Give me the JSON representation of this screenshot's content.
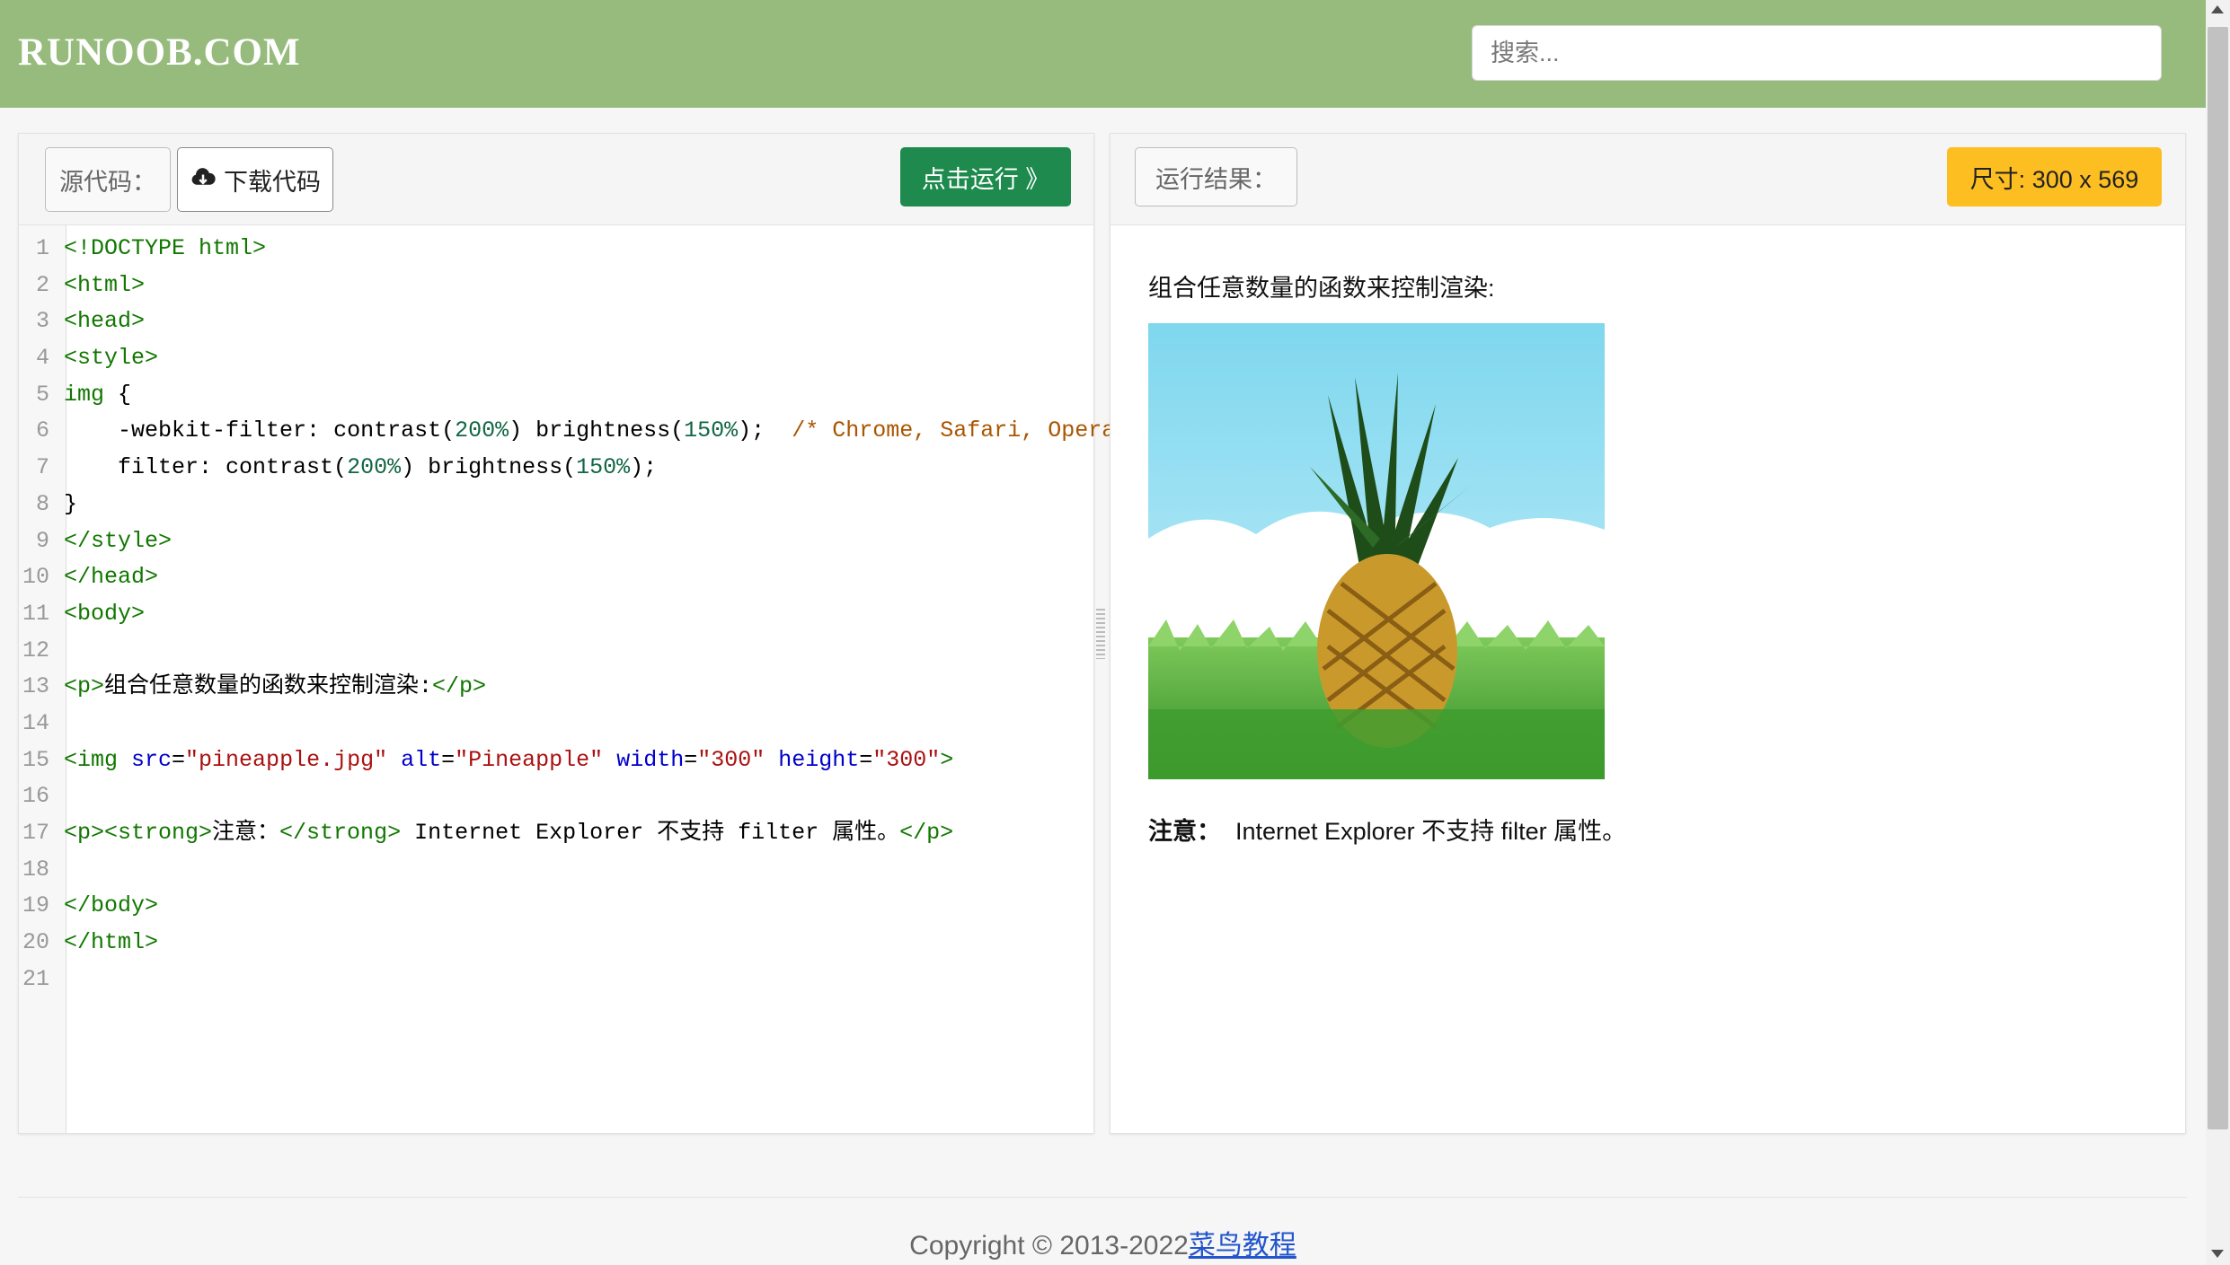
{
  "header": {
    "logo": "RUNOOB.COM",
    "search_placeholder": "搜索..."
  },
  "left_panel": {
    "source_label": "源代码：",
    "download_label": "下载代码",
    "run_label": "点击运行 》",
    "line_numbers": [
      "1",
      "2",
      "3",
      "4",
      "5",
      "6",
      "7",
      "8",
      "9",
      "10",
      "11",
      "12",
      "13",
      "14",
      "15",
      "16",
      "17",
      "18",
      "19",
      "20",
      "21"
    ],
    "code": {
      "l1": "<!DOCTYPE html>",
      "l2": "<html>",
      "l3": "<head>",
      "l4": "<style>",
      "l5_sel": "img",
      "l5_brace": " {",
      "l6_prop": "    -webkit-filter: ",
      "l6_fn1": "contrast(",
      "l6_n1": "200%",
      "l6_fn2": ") brightness(",
      "l6_n2": "150%",
      "l6_end": ");  ",
      "l6_cmt": "/* Chrome, Safari, Opera */",
      "l7_prop": "    filter: ",
      "l7_fn1": "contrast(",
      "l7_n1": "200%",
      "l7_fn2": ") brightness(",
      "l7_n2": "150%",
      "l7_end": ");",
      "l8": "}",
      "l9": "</style>",
      "l10": "</head>",
      "l11": "<body>",
      "l13_open": "<p>",
      "l13_text": "组合任意数量的函数来控制渲染:",
      "l13_close": "</p>",
      "l15_tag": "<img ",
      "l15_a1": "src",
      "l15_v1": "\"pineapple.jpg\"",
      "l15_a2": "alt",
      "l15_v2": "\"Pineapple\"",
      "l15_a3": "width",
      "l15_v3": "\"300\"",
      "l15_a4": "height",
      "l15_v4": "\"300\"",
      "l15_end": ">",
      "l17_p": "<p><strong>",
      "l17_t1": "注意：",
      "l17_cs": "</strong>",
      "l17_t2": " Internet Explorer 不支持 filter 属性。",
      "l17_cp": "</p>",
      "l19": "</body>",
      "l20": "</html>"
    }
  },
  "right_panel": {
    "result_label": "运行结果：",
    "size_label": "尺寸: 300 x 569",
    "paragraph": "组合任意数量的函数来控制渲染:",
    "image_alt": "Pineapple",
    "note_strong": "注意：",
    "note_text": "Internet Explorer 不支持 filter 属性。"
  },
  "footer": {
    "copyright": "Copyright © 2013-2022",
    "link": "菜鸟教程"
  },
  "colors": {
    "header_bg": "#96bb7c",
    "run_button": "#1e8a4e",
    "size_badge": "#fdbe22"
  }
}
